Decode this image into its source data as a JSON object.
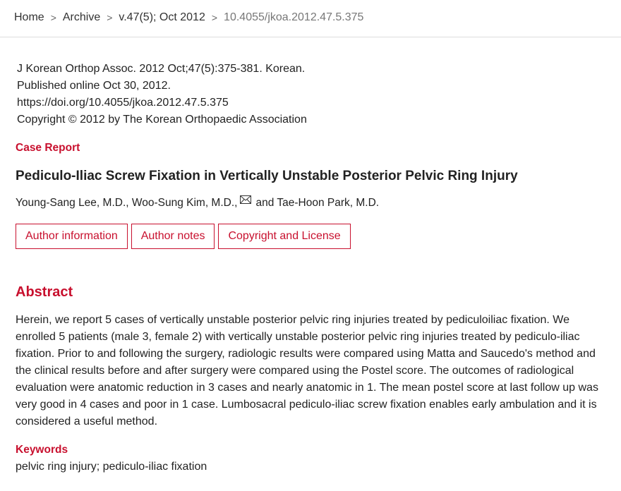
{
  "breadcrumb": {
    "separator": ">",
    "items": [
      "Home",
      "Archive",
      "v.47(5); Oct 2012",
      "10.4055/jkoa.2012.47.5.375"
    ]
  },
  "citation": {
    "journal_line": "J Korean Orthop Assoc. 2012 Oct;47(5):375-381. Korean.",
    "published": "Published online Oct 30, 2012.",
    "doi_url": "https://doi.org/10.4055/jkoa.2012.47.5.375",
    "copyright": "Copyright © 2012 by The Korean Orthopaedic Association"
  },
  "article": {
    "type": "Case Report",
    "title": "Pediculo-Iliac Screw Fixation in Vertically Unstable Posterior Pelvic Ring Injury",
    "authors": {
      "before_icon": "Young-Sang Lee, M.D., Woo-Sung Kim, M.D.,",
      "icon": "envelope-icon",
      "after_icon": "and Tae-Hoon Park, M.D."
    }
  },
  "buttons": [
    {
      "label": "Author information"
    },
    {
      "label": "Author notes"
    },
    {
      "label": "Copyright and License"
    }
  ],
  "abstract": {
    "heading": "Abstract",
    "text": "Herein, we report 5 cases of vertically unstable posterior pelvic ring injuries treated by pediculoiliac fixation. We enrolled 5 patients (male 3, female 2) with vertically unstable posterior pelvic ring injuries treated by pediculo-iliac fixation. Prior to and following the surgery, radiologic results were compared using Matta and Saucedo's method and the clinical results before and after surgery were compared using the Postel score. The outcomes of radiological evaluation were anatomic reduction in 3 cases and nearly anatomic in 1. The mean postel score at last follow up was very good in 4 cases and poor in 1 case. Lumbosacral pediculo-iliac screw fixation enables early ambulation and it is considered a useful method."
  },
  "keywords": {
    "heading": "Keywords",
    "text": "pelvic ring injury; pediculo-iliac fixation"
  },
  "colors": {
    "accent": "#c8102e",
    "text": "#222222",
    "muted": "#777777",
    "divider": "#dddddd"
  }
}
